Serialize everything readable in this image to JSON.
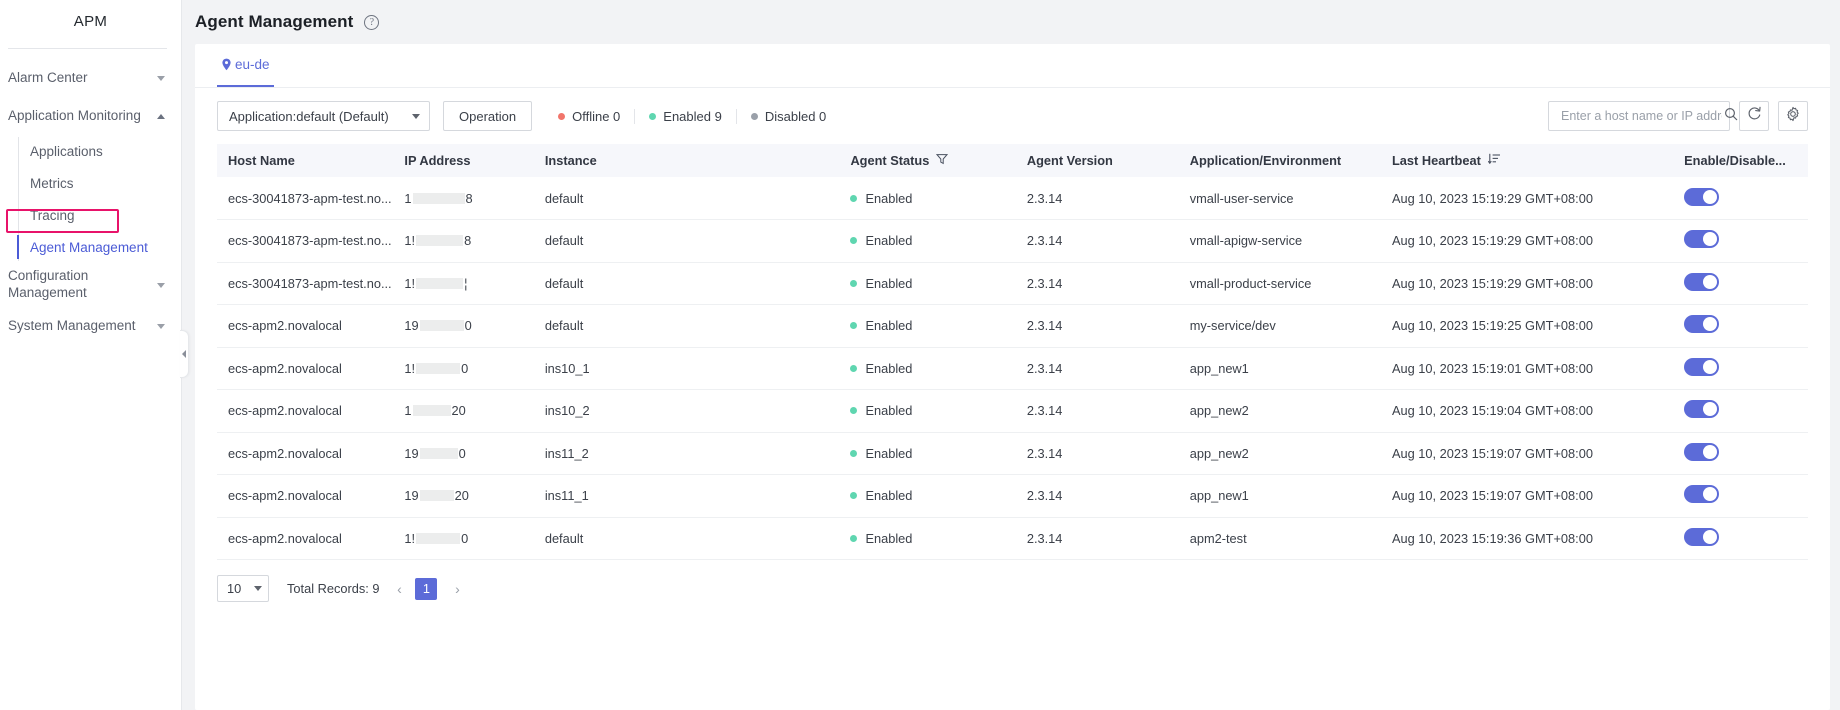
{
  "sidebar": {
    "title": "APM",
    "groups": [
      {
        "label": "Alarm Center",
        "expanded": false
      },
      {
        "label": "Application Monitoring",
        "expanded": true
      },
      {
        "label": "Configuration Management",
        "expanded": false
      },
      {
        "label": "System Management",
        "expanded": false
      }
    ],
    "sub_items": [
      {
        "label": "Applications",
        "active": false
      },
      {
        "label": "Metrics",
        "active": false
      },
      {
        "label": "Tracing",
        "active": false
      },
      {
        "label": "Agent Management",
        "active": true
      }
    ]
  },
  "header": {
    "title": "Agent Management",
    "help_icon": "question-mark-circle-icon"
  },
  "tabs": [
    {
      "label": "eu-de",
      "icon": "location-pin-icon",
      "active": true
    }
  ],
  "toolbar": {
    "application_select": "Application:default (Default)",
    "operation_button": "Operation",
    "stats": [
      {
        "label": "Offline 0",
        "color": "#f1756b"
      },
      {
        "label": "Enabled 9",
        "color": "#5fd6b0"
      },
      {
        "label": "Disabled 0",
        "color": "#9aa0a9"
      }
    ],
    "search_placeholder": "Enter a host name or IP address.",
    "search_value": "",
    "search_icon": "search-icon",
    "refresh_icon": "refresh-icon",
    "settings_icon": "gear-icon"
  },
  "table": {
    "columns": [
      "Host Name",
      "IP Address",
      "Instance",
      "Agent Status",
      "Agent Version",
      "Application/Environment",
      "Last Heartbeat",
      "Enable/Disable..."
    ],
    "filter_icon": "filter-icon",
    "sort_icon": "sort-icon",
    "rows": [
      {
        "host": "ecs-30041873-apm-test.no...",
        "ip_prefix": "1",
        "ip_suffix": "8",
        "ip_mask_width": 52,
        "instance": "default",
        "status": "Enabled",
        "version": "2.3.14",
        "environment": "vmall-user-service",
        "heartbeat": "Aug 10, 2023 15:19:29 GMT+08:00",
        "enabled": true
      },
      {
        "host": "ecs-30041873-apm-test.no...",
        "ip_prefix": "1!",
        "ip_suffix": "8",
        "ip_mask_width": 47,
        "instance": "default",
        "status": "Enabled",
        "version": "2.3.14",
        "environment": "vmall-apigw-service",
        "heartbeat": "Aug 10, 2023 15:19:29 GMT+08:00",
        "enabled": true
      },
      {
        "host": "ecs-30041873-apm-test.no...",
        "ip_prefix": "1!",
        "ip_suffix": "¦",
        "ip_mask_width": 47,
        "instance": "default",
        "status": "Enabled",
        "version": "2.3.14",
        "environment": "vmall-product-service",
        "heartbeat": "Aug 10, 2023 15:19:29 GMT+08:00",
        "enabled": true
      },
      {
        "host": "ecs-apm2.novalocal",
        "ip_prefix": "19",
        "ip_suffix": "0",
        "ip_mask_width": 44,
        "instance": "default",
        "status": "Enabled",
        "version": "2.3.14",
        "environment": "my-service/dev",
        "heartbeat": "Aug 10, 2023 15:19:25 GMT+08:00",
        "enabled": true
      },
      {
        "host": "ecs-apm2.novalocal",
        "ip_prefix": "1!",
        "ip_suffix": "0",
        "ip_mask_width": 44,
        "instance": "ins10_1",
        "status": "Enabled",
        "version": "2.3.14",
        "environment": "app_new1",
        "heartbeat": "Aug 10, 2023 15:19:01 GMT+08:00",
        "enabled": true
      },
      {
        "host": "ecs-apm2.novalocal",
        "ip_prefix": "1",
        "ip_suffix": "20",
        "ip_mask_width": 38,
        "instance": "ins10_2",
        "status": "Enabled",
        "version": "2.3.14",
        "environment": "app_new2",
        "heartbeat": "Aug 10, 2023 15:19:04 GMT+08:00",
        "enabled": true
      },
      {
        "host": "ecs-apm2.novalocal",
        "ip_prefix": "19",
        "ip_suffix": "0",
        "ip_mask_width": 38,
        "instance": "ins11_2",
        "status": "Enabled",
        "version": "2.3.14",
        "environment": "app_new2",
        "heartbeat": "Aug 10, 2023 15:19:07 GMT+08:00",
        "enabled": true
      },
      {
        "host": "ecs-apm2.novalocal",
        "ip_prefix": "19",
        "ip_suffix": "20",
        "ip_mask_width": 34,
        "instance": "ins11_1",
        "status": "Enabled",
        "version": "2.3.14",
        "environment": "app_new1",
        "heartbeat": "Aug 10, 2023 15:19:07 GMT+08:00",
        "enabled": true
      },
      {
        "host": "ecs-apm2.novalocal",
        "ip_prefix": "1!",
        "ip_suffix": "0",
        "ip_mask_width": 44,
        "instance": "default",
        "status": "Enabled",
        "version": "2.3.14",
        "environment": "apm2-test",
        "heartbeat": "Aug 10, 2023 15:19:36 GMT+08:00",
        "enabled": true
      }
    ]
  },
  "pagination": {
    "page_size": "10",
    "total_records": "Total Records: 9",
    "prev": "‹",
    "current_page": "1",
    "next": "›"
  },
  "colors": {
    "accent": "#5c6bd8",
    "highlight": "#e8136a",
    "status_enabled": "#5fd6b0",
    "status_offline": "#f1756b",
    "status_disabled": "#9aa0a9"
  }
}
